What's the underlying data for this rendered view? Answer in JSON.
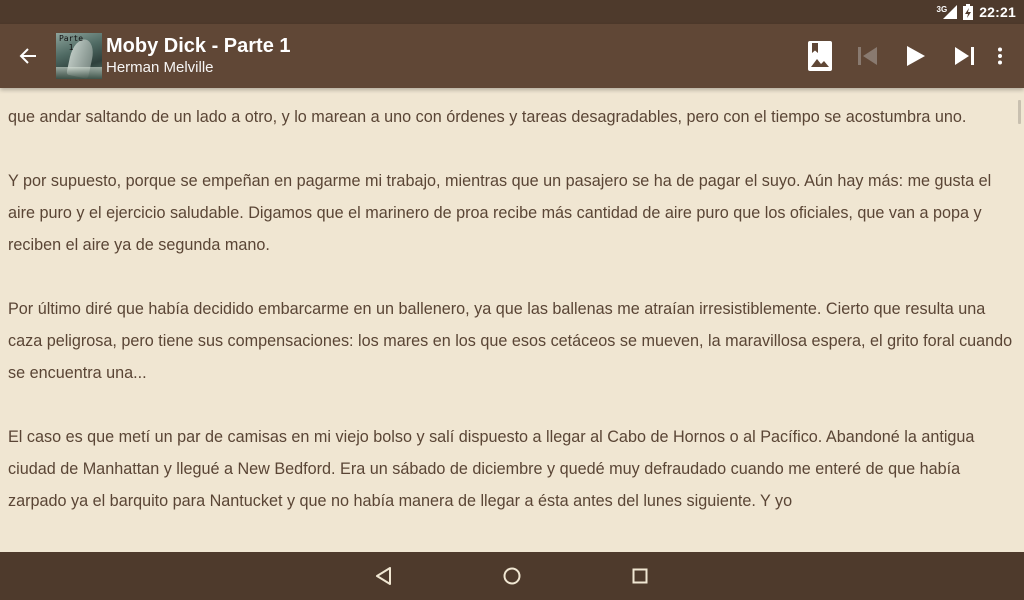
{
  "status_bar": {
    "network_label": "3G",
    "time": "22:21"
  },
  "app_bar": {
    "title": "Moby Dick - Parte 1",
    "subtitle": "Herman Melville",
    "cover_label": "Parte 1",
    "icons": {
      "back": "arrow-back-icon",
      "bookmark_image": "bookmark-image-icon",
      "previous": "skip-previous-icon",
      "play": "play-icon",
      "next": "skip-next-icon",
      "overflow": "more-vert-icon"
    }
  },
  "content": {
    "paragraphs": [
      "que andar saltando de un lado a otro, y lo marean a uno con órdenes y tareas desagradables, pero con el tiempo se acostumbra uno.",
      "Y por supuesto, porque se empeñan en pagarme mi trabajo, mientras que un pasajero se ha de pagar el suyo. Aún hay más: me gusta el aire puro y el ejercicio saludable. Digamos que el marinero de proa recibe más cantidad de aire puro que los oficiales, que van a popa y reciben el aire ya de segunda mano.",
      "Por último diré que había decidido embarcarme en un ballenero, ya que las ballenas me atraían irresistiblemente. Cierto que resulta una caza peligrosa, pero tiene sus compensaciones: los mares en los que esos cetáceos se mueven, la maravillosa espera, el grito foral cuando se encuentra una...",
      "El caso es que metí un par de camisas en mi viejo bolso y salí dispuesto a llegar al Cabo de Hornos o al Pacífico. Abandoné la antigua ciudad de Manhattan y llegué a New Bedford. Era un sábado de diciembre y quedé muy defraudado cuando me enteré de que había zarpado ya el barquito para Nantucket y que no había manera de llegar a ésta antes del lunes siguiente. Y yo"
    ]
  },
  "nav_bar": {
    "icons": {
      "back": "nav-back-icon",
      "home": "nav-home-icon",
      "recents": "nav-recents-icon"
    }
  },
  "colors": {
    "status_bar": "#4e3a2c",
    "app_bar": "#604736",
    "page_background": "#f0e6d2",
    "text": "#5a4535",
    "nav_bar": "#4e3a2c"
  }
}
